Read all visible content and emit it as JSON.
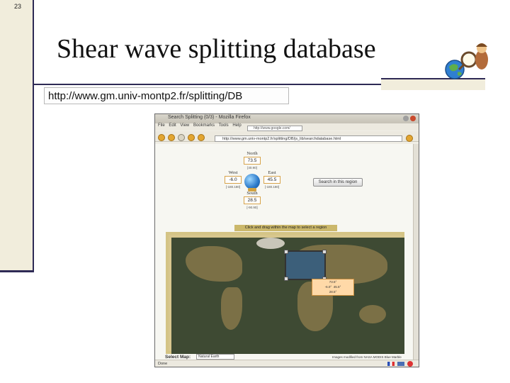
{
  "slide": {
    "number": "23",
    "title": "Shear wave splitting database",
    "url": "http://www.gm.univ-montp2.fr/splitting/DB",
    "logo_icon": "globe-magnifier-icon"
  },
  "browser": {
    "window_title": "Search Splitting (0/3) - Mozilla Firefox",
    "menu": [
      "File",
      "Edit",
      "View",
      "Bookmarks",
      "Tools",
      "Help"
    ],
    "google_search": "http://www.google.com/",
    "address": "http://www.gm.univ-montp2.fr/splitting/DB/js_lib/searchdatabase.html",
    "form": {
      "north_label": "North",
      "north_value": "73.5",
      "north_unit": "[40.90]",
      "west_label": "West",
      "west_value": "-6.0",
      "west_unit": "[-180.180]",
      "east_label": "East",
      "east_value": "45.5",
      "east_unit": "[-180.180]",
      "south_label": "South",
      "south_value": "28.5",
      "south_unit": "[-90.90]",
      "search_button": "Search in this region"
    },
    "map": {
      "instruction": "Click and drag within the map to select a region",
      "selection_north": "73.5°",
      "selection_west": "-6.0°",
      "selection_east": "45.5°",
      "selection_south": "28.5°"
    },
    "select_map_label": "Select Map:",
    "select_map_value": "Natural Earth",
    "map_credit": "Images modified from NASA MODIS Blue Marble",
    "status": "Done"
  }
}
